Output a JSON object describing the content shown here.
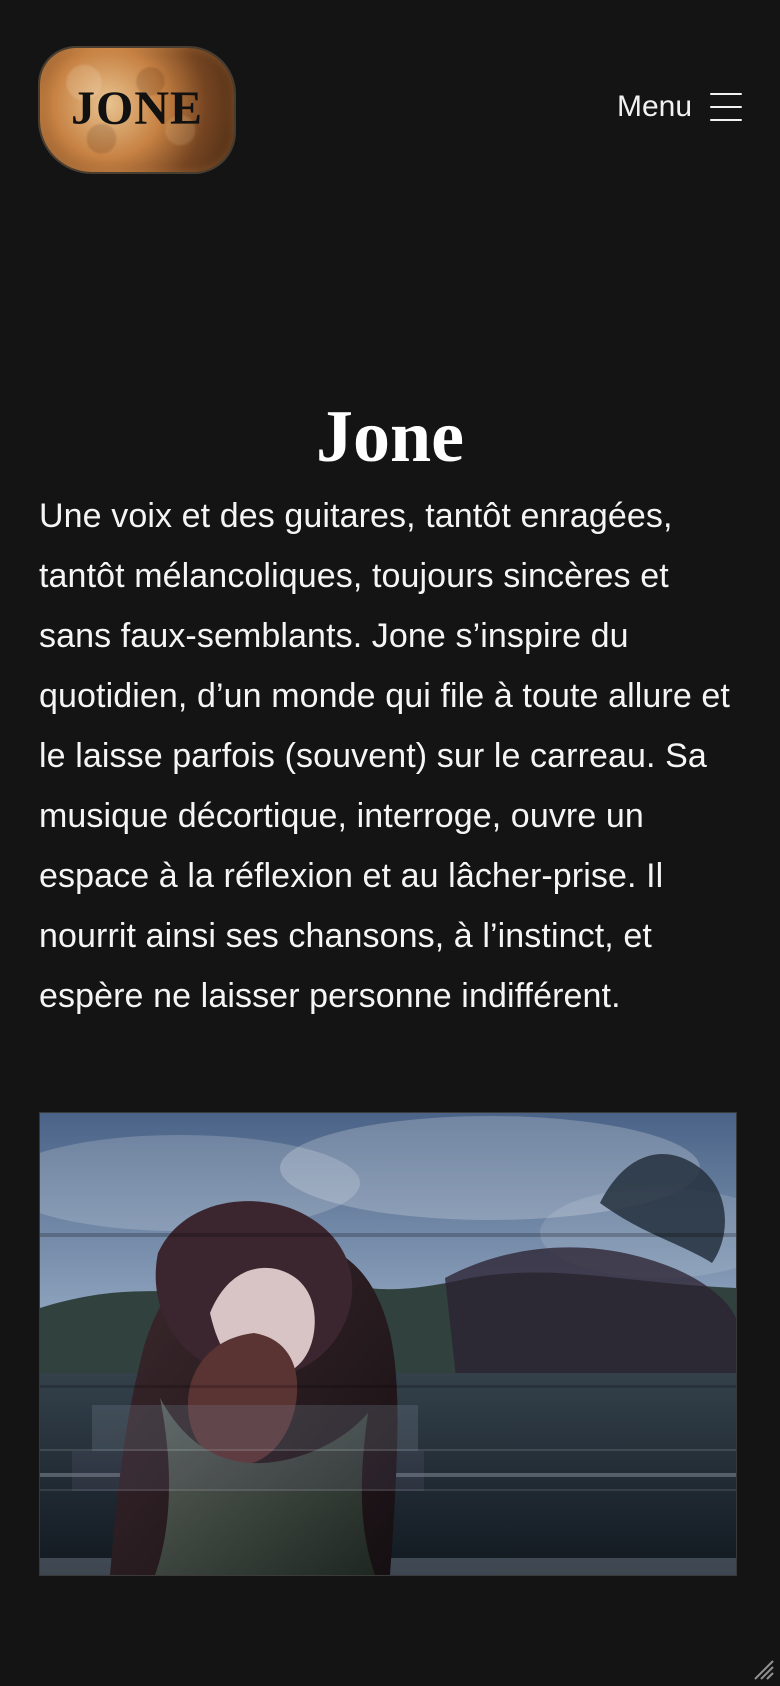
{
  "header": {
    "logo_text": "JONE",
    "menu_label": "Menu"
  },
  "hero": {
    "title": "Jone",
    "description": "Une voix et des guitares, tantôt enragées, tantôt mélancoliques, toujours sincères et sans faux-semblants. Jone s’inspire du quotidien, d’un monde qui file à toute allure et le laisse parfois (souvent) sur le carreau. Sa musique décortique, interroge, ouvre un espace à la réflexion et au lâcher-prise. Il nourrit ainsi ses chansons, à l’instinct, et espère ne laisser personne indifférent."
  },
  "media": {
    "image_icon": "portrait-photo-icon"
  },
  "colors": {
    "background": "#141414",
    "text": "#f5f5f5",
    "logo_accent": "#c97a3c"
  }
}
